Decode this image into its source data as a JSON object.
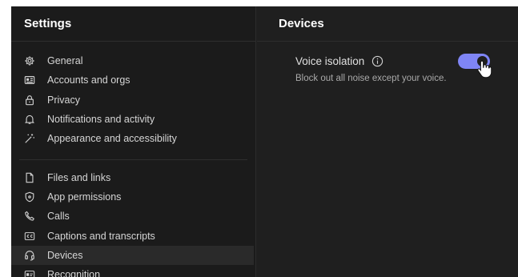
{
  "sidebar": {
    "title": "Settings",
    "group1": [
      {
        "label": "General",
        "icon": "gear-icon"
      },
      {
        "label": "Accounts and orgs",
        "icon": "id-card-icon"
      },
      {
        "label": "Privacy",
        "icon": "lock-icon"
      },
      {
        "label": "Notifications and activity",
        "icon": "bell-icon"
      },
      {
        "label": "Appearance and accessibility",
        "icon": "magic-wand-icon"
      }
    ],
    "group2": [
      {
        "label": "Files and links",
        "icon": "file-icon"
      },
      {
        "label": "App permissions",
        "icon": "shield-icon"
      },
      {
        "label": "Calls",
        "icon": "phone-icon"
      },
      {
        "label": "Captions and transcripts",
        "icon": "closed-captions-icon"
      },
      {
        "label": "Devices",
        "icon": "headset-icon",
        "active": true
      },
      {
        "label": "Recognition",
        "icon": "recognition-icon"
      }
    ]
  },
  "main": {
    "title": "Devices",
    "voice_isolation": {
      "title": "Voice isolation",
      "description": "Block out all noise except your voice.",
      "enabled": true
    }
  },
  "colors": {
    "accent": "#7f85f5",
    "background": "#1f1f1f",
    "sidebar_background": "#1b1b1b",
    "active_item": "#2a2a2a"
  }
}
